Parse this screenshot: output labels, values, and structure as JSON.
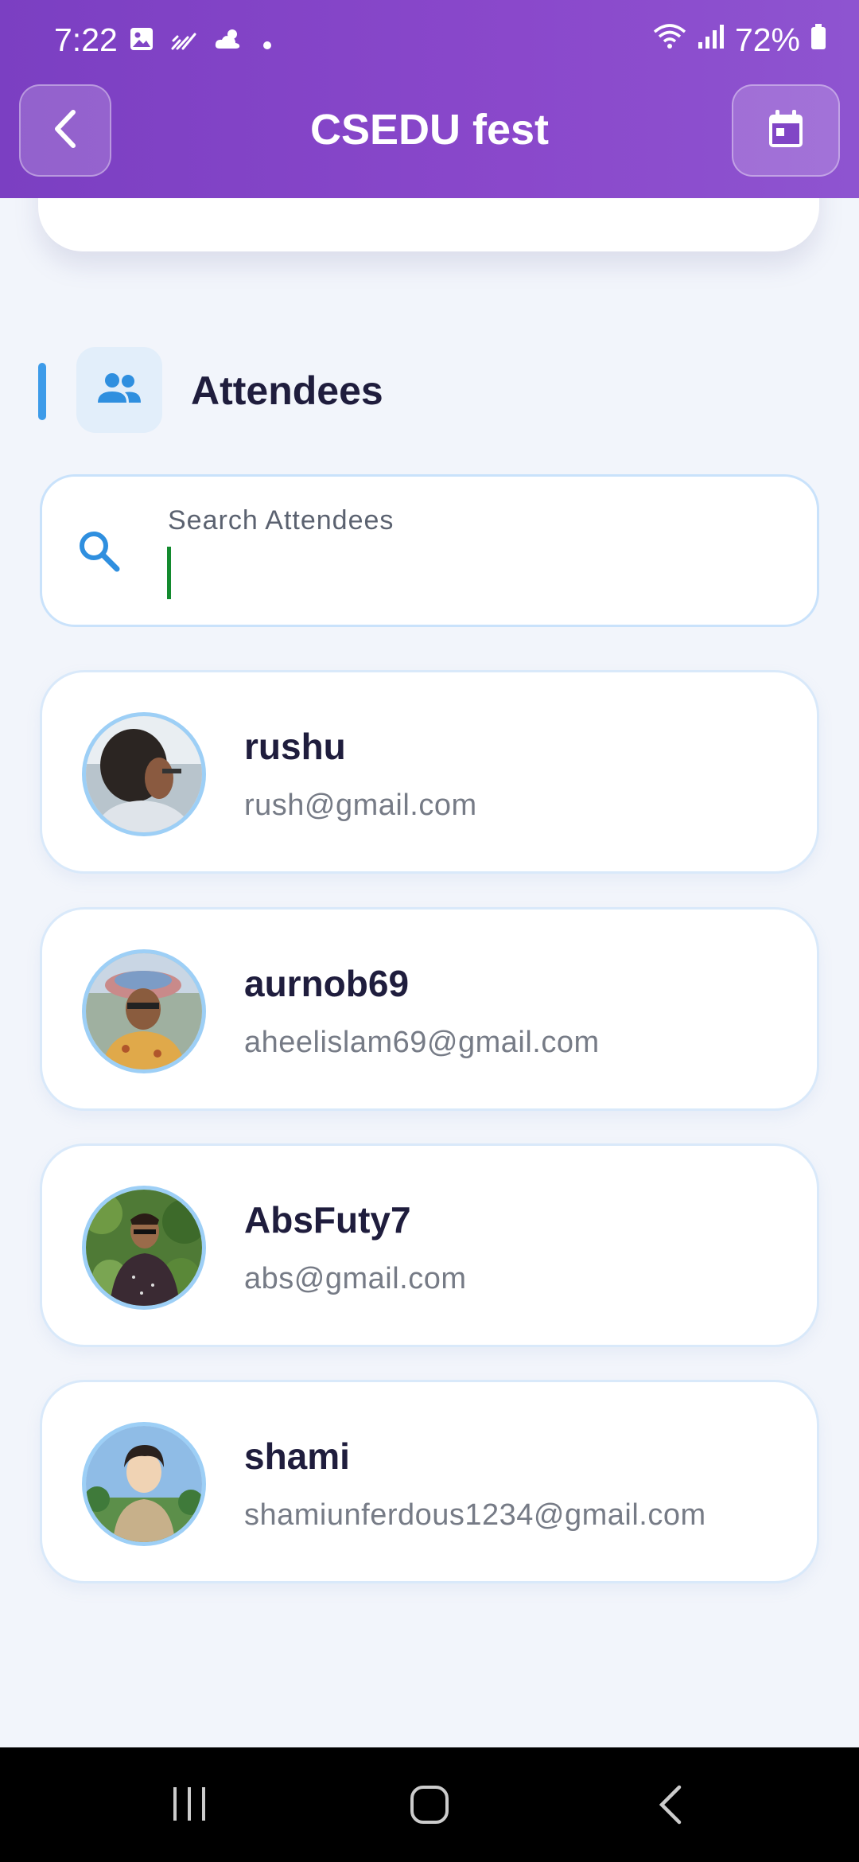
{
  "status_bar": {
    "time": "7:22",
    "battery": "72%",
    "icons_left": [
      "image-icon",
      "activity-icon",
      "weather-icon",
      "dot-icon"
    ],
    "icons_right": [
      "wifi-icon",
      "signal-icon",
      "battery-icon"
    ]
  },
  "header": {
    "title": "CSEDU fest",
    "back_icon": "chevron-left-icon",
    "calendar_icon": "calendar-icon",
    "color": "#8146c6"
  },
  "attendees_section": {
    "title": "Attendees",
    "icon": "people-icon",
    "accent_color": "#3d9be9"
  },
  "search": {
    "label": "Search Attendees",
    "value": ""
  },
  "attendees": [
    {
      "name": "rushu",
      "email": "rush@gmail.com"
    },
    {
      "name": "aurnob69",
      "email": "aheelislam69@gmail.com"
    },
    {
      "name": "AbsFuty7",
      "email": "abs@gmail.com"
    },
    {
      "name": "shami",
      "email": "shamiunferdous1234@gmail.com"
    }
  ],
  "nav_bar": {
    "buttons": [
      "recent-apps-icon",
      "home-icon",
      "back-icon"
    ]
  }
}
